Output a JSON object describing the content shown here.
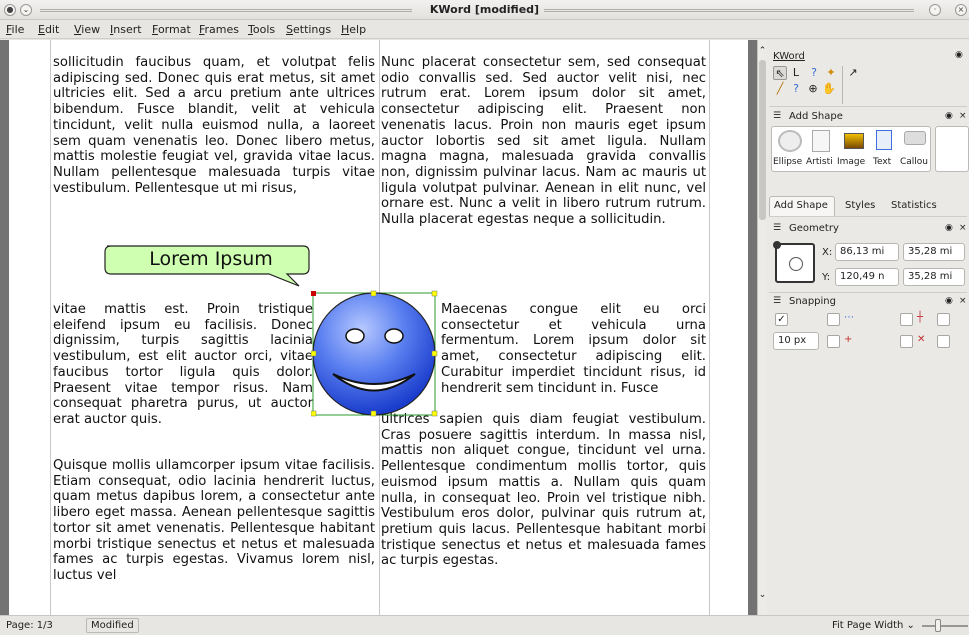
{
  "window": {
    "title": "KWord [modified]"
  },
  "menu": [
    "File",
    "Edit",
    "View",
    "Insert",
    "Format",
    "Frames",
    "Tools",
    "Settings",
    "Help"
  ],
  "document": {
    "left_top": "sollicitudin faucibus quam, et volutpat felis adipiscing sed. Donec quis erat metus, sit amet ultricies elit. Sed a arcu pretium ante ultrices bibendum. Fusce blandit, velit at vehicula tincidunt, velit nulla euismod nulla, a laoreet sem quam venenatis leo. Donec libero metus, mattis molestie feugiat vel, gravida vitae lacus. Nullam pellentesque malesuada turpis vitae vestibulum. Pellentesque ut mi risus,",
    "left_mid": "vitae mattis est. Proin tristique eleifend ipsum eu facilisis. Donec dignissim, turpis sagittis lacinia vestibulum, est elit auctor orci, vitae faucibus tortor ligula quis dolor. Praesent vitae tempor risus. Nam consequat pharetra purus, ut auctor erat auctor quis.",
    "left_bottom": "Quisque mollis ullamcorper ipsum vitae facilisis. Etiam consequat, odio lacinia hendrerit luctus, quam metus dapibus lorem, a consectetur ante libero eget massa. Aenean pellentesque sagittis tortor sit amet venenatis. Pellentesque habitant morbi tristique senectus et netus et malesuada fames ac turpis egestas. Vivamus lorem nisl, luctus vel",
    "right_top": "Nunc placerat consectetur sem, sed consequat odio convallis sed. Sed auctor velit nisi, nec rutrum erat. Lorem ipsum dolor sit amet, consectetur adipiscing elit. Praesent non venenatis lacus. Proin non mauris eget ipsum auctor lobortis sed sit amet ligula. Nullam magna magna, malesuada gravida convallis non, dignissim pulvinar lacus. Nam ac mauris ut ligula volutpat pulvinar. Aenean in elit nunc, vel ornare est. Nunc a velit in libero rutrum rutrum. Nulla placerat egestas neque a sollicitudin.",
    "right_mid": "Maecenas congue elit eu orci consectetur et vehicula urna fermentum. Lorem ipsum dolor sit amet, consectetur adipiscing elit. Curabitur imperdiet tincidunt risus, id hendrerit sem tincidunt in. Fusce",
    "right_bottom": "ultrices sapien quis diam feugiat vestibulum. Cras posuere sagittis interdum. In massa nisl, mattis non aliquet congue, tincidunt vel urna. Pellentesque condimentum mollis tortor, quis euismod ipsum mattis a. Nullam quis quam nulla, in consequat leo. Proin vel tristique nibh. Vestibulum eros dolor, pulvinar quis rutrum at, pretium quis lacus. Pellentesque habitant morbi tristique senectus et netus et malesuada fames ac turpis egestas.",
    "callout_text": "Lorem Ipsum"
  },
  "docker": {
    "kword_title": "KWord",
    "add_shape_title": "Add Shape",
    "shapes": [
      "Ellipse",
      "Artisti",
      "Image",
      "Text",
      "Callou"
    ],
    "tabs": [
      "Add Shape",
      "Styles",
      "Statistics"
    ],
    "geometry_title": "Geometry",
    "x_label": "X:",
    "y_label": "Y:",
    "x_value": "86,13 mi",
    "y_value": "120,49 n",
    "w_value": "35,28 mi",
    "h_value": "35,28 mi",
    "snapping_title": "Snapping",
    "snap_distance": "10 px"
  },
  "status": {
    "page": "Page: 1/3",
    "modified": "Modified",
    "zoom": "Fit Page Width"
  },
  "colors": {
    "accent": "#3d6de0",
    "smiley_light": "#9bb5ff",
    "smiley_dark": "#1a3ccc",
    "callout_fill": "#cfffb0",
    "selection": "#2a9d2a"
  }
}
